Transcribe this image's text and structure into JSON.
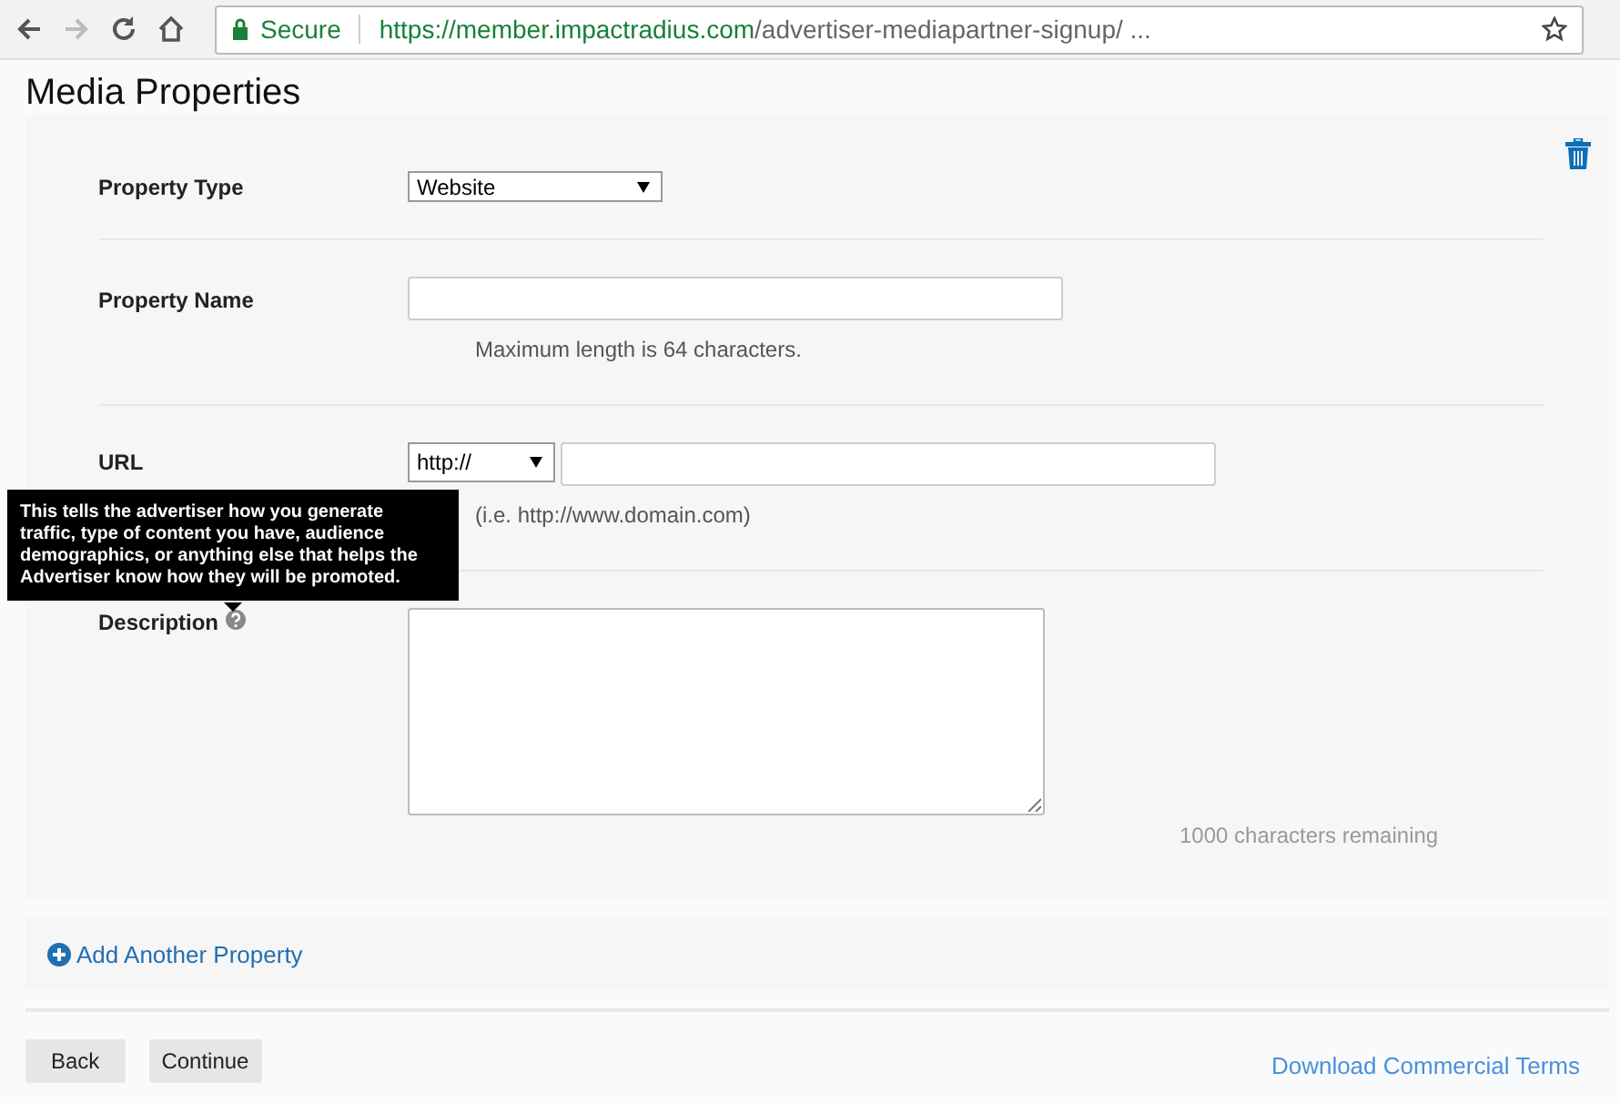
{
  "browser": {
    "security_label": "Secure",
    "url_host": "https://member.impactradius.com",
    "url_path": "/advertiser-mediapartner-signup/ ..."
  },
  "page_title": "Media Properties",
  "form": {
    "fields": [
      {
        "kind": "select",
        "label": "Property Type",
        "value": "Website"
      },
      {
        "kind": "text",
        "label": "Property Name",
        "hint": "Maximum length is 64 characters."
      },
      {
        "kind": "url",
        "label": "URL",
        "prefix": "http://",
        "hint": "(i.e. http://www.domain.com)"
      },
      {
        "kind": "textarea",
        "label": "Description",
        "help": true,
        "counter": "1000 characters remaining"
      }
    ]
  },
  "tooltip": "This tells the advertiser how you generate traffic, type of content you have, audience demographics, or anything else that helps the Advertiser know how they will be promoted.",
  "add_link": "Add Another Property",
  "buttons": [
    "Back",
    "Continue"
  ],
  "terms_link": "Download Commercial Terms"
}
